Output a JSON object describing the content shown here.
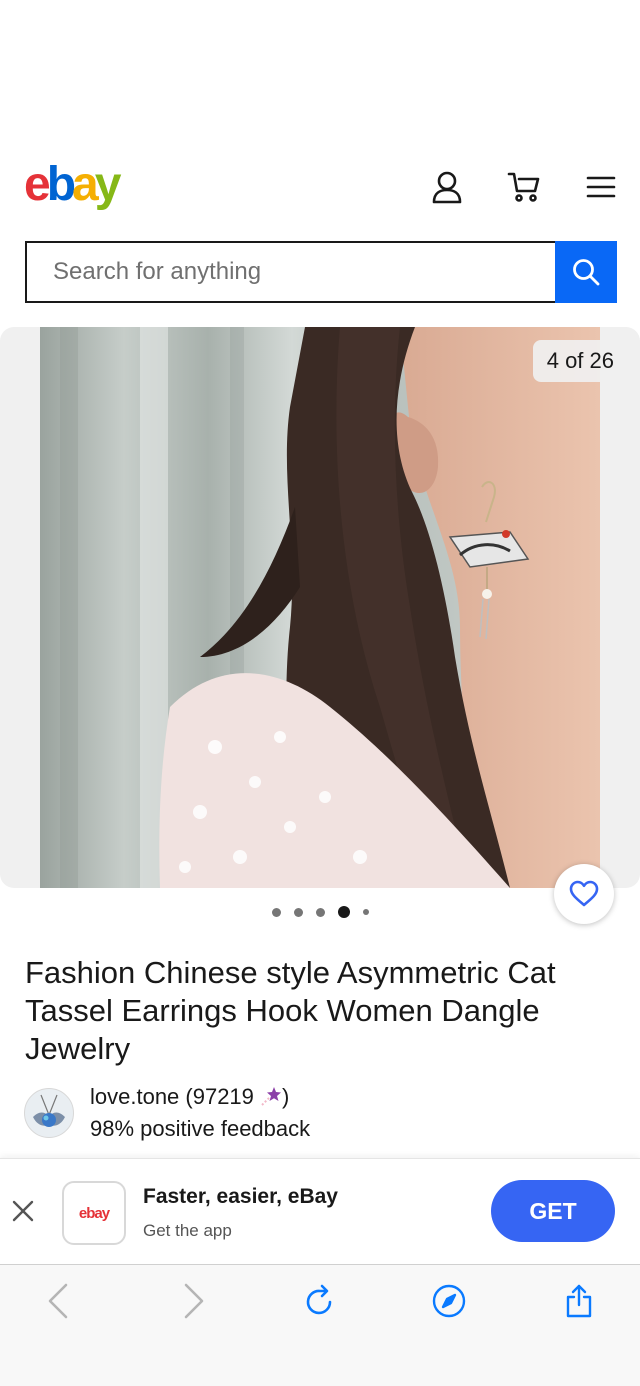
{
  "header": {
    "logo_letters": [
      "e",
      "b",
      "a",
      "y"
    ],
    "logo_colors": [
      "#e53238",
      "#0064d2",
      "#f5af02",
      "#86b817"
    ],
    "icons": [
      "account-icon",
      "cart-icon",
      "menu-icon"
    ]
  },
  "search": {
    "placeholder": "Search for anything",
    "button_icon": "search-icon"
  },
  "gallery": {
    "counter": "4 of 26",
    "current_index": 4,
    "total": 26,
    "dots_visible": 5,
    "active_dot": 4
  },
  "listing": {
    "title": "Fashion Chinese style Asymmetric Cat Tassel Earrings Hook Women Dangle Jewelry"
  },
  "seller": {
    "name_prefix": "love.tone (97219 ",
    "name_suffix": ")",
    "feedback": "98% positive feedback",
    "badge_icon": "shooting-star-icon"
  },
  "app_banner": {
    "app_logo": "ebay",
    "title": "Faster, easier, eBay",
    "subtitle": "Get the app",
    "button": "GET",
    "button_color": "#3665f3"
  },
  "browser_toolbar": {
    "icons": [
      "back-icon",
      "forward-icon",
      "reload-icon",
      "compass-icon",
      "share-icon"
    ],
    "accent": "#0a7aff"
  }
}
